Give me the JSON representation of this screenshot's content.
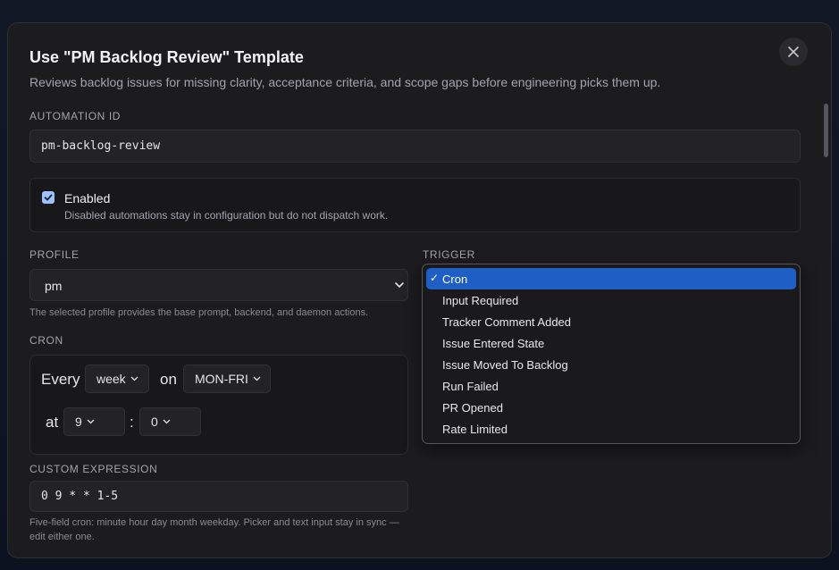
{
  "dialog": {
    "title": "Use \"PM Backlog Review\" Template",
    "subtitle": "Reviews backlog issues for missing clarity, acceptance criteria, and scope gaps before engineering picks them up."
  },
  "automation_id": {
    "label": "AUTOMATION ID",
    "value": "pm-backlog-review"
  },
  "enabled": {
    "checked": true,
    "label": "Enabled",
    "description": "Disabled automations stay in configuration but do not dispatch work."
  },
  "profile": {
    "label": "PROFILE",
    "value": "pm",
    "hint": "The selected profile provides the base prompt, backend, and daemon actions."
  },
  "cron": {
    "label": "CRON",
    "every_word": "Every",
    "period": "week",
    "on_word": "on",
    "days": "MON-FRI",
    "at_word": "at",
    "hour": "9",
    "separator": ":",
    "minute": "0"
  },
  "custom_expression": {
    "label": "CUSTOM EXPRESSION",
    "value": "0 9 * * 1-5",
    "hint": "Five-field cron: minute hour day month weekday. Picker and text input stay in sync — edit either one."
  },
  "trigger": {
    "label": "TRIGGER",
    "selected_check": "✓",
    "options": [
      "Cron",
      "Input Required",
      "Tracker Comment Added",
      "Issue Entered State",
      "Issue Moved To Backlog",
      "Run Failed",
      "PR Opened",
      "Rate Limited"
    ],
    "selected_index": 0
  },
  "colors": {
    "accent": "#1f5fc5",
    "checkbox": "#9fc2ff",
    "modal_bg": "#1c1c1f"
  },
  "icons": {
    "close": "close-icon",
    "chevron": "chevron-down-icon",
    "check": "checkmark-icon"
  }
}
